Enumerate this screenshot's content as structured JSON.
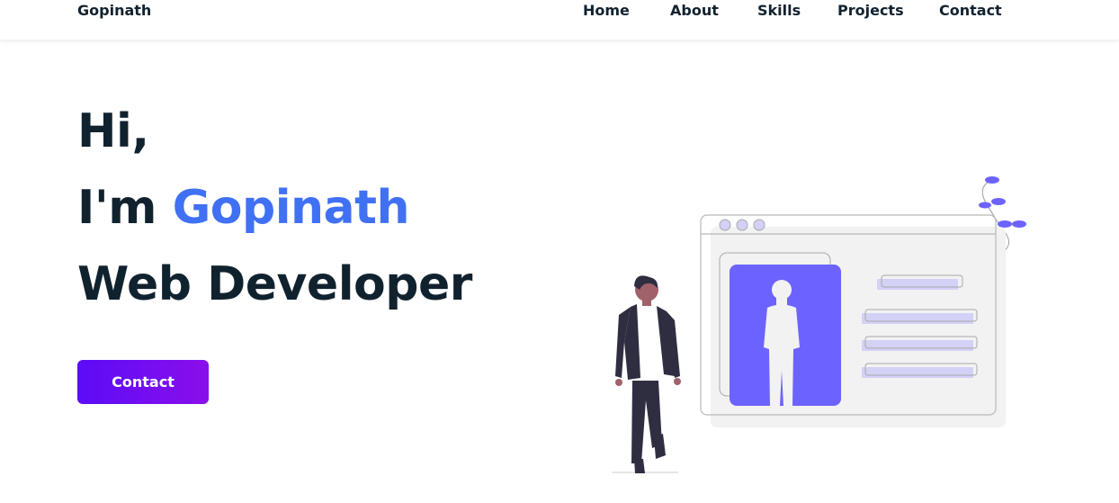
{
  "header": {
    "logo": "Gopinath",
    "nav": [
      {
        "label": "Home"
      },
      {
        "label": "About"
      },
      {
        "label": "Skills"
      },
      {
        "label": "Projects"
      },
      {
        "label": "Contact"
      }
    ]
  },
  "hero": {
    "greeting": "Hi,",
    "intro_prefix": "I'm ",
    "name": "Gopinath",
    "role": "Web Developer",
    "cta_label": "Contact"
  },
  "colors": {
    "accent_blue": "#4070f4",
    "illustration_purple": "#6c63ff",
    "button_gradient_start": "#5b0cf6",
    "button_gradient_end": "#8a0fea",
    "text_dark": "#11222f"
  },
  "illustration": {
    "icon": "web-developer-illustration"
  }
}
